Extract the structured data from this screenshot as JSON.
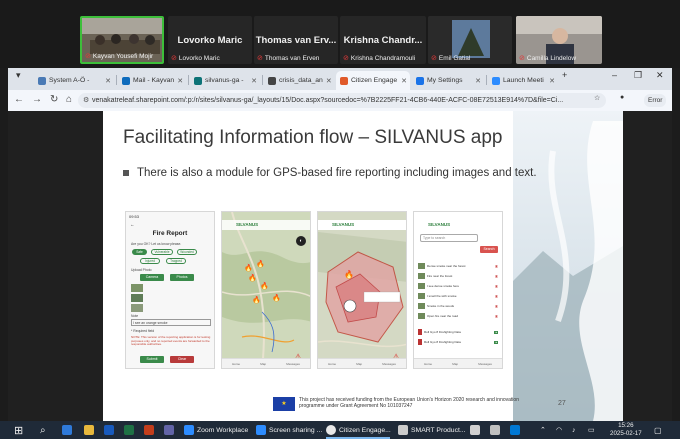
{
  "zoom": {
    "participants": [
      {
        "name": "Kayvan Yousefi Mojir",
        "has_video": true,
        "active": true
      },
      {
        "name": "Lovorko Maric",
        "sub": "Lovorko Maric",
        "has_video": false
      },
      {
        "name": "Thomas van Erv...",
        "sub": "Thomas van Erven",
        "has_video": false
      },
      {
        "name": "Krishna Chandr...",
        "sub": "Krishna Chandramouli",
        "has_video": false
      },
      {
        "name": "Emil Gatial",
        "has_video": true
      },
      {
        "name": "Camilla Lindelow",
        "has_video": true
      }
    ]
  },
  "browser": {
    "tabs": [
      {
        "label": "System A-Ö -",
        "color": "#4a7ab5"
      },
      {
        "label": "Mail - Kayvan",
        "color": "#0f6cbd"
      },
      {
        "label": "silvanus-ga -",
        "color": "#0d7377"
      },
      {
        "label": "crisis_data_an",
        "color": "#444444"
      },
      {
        "label": "Citizen Engage",
        "color": "#e05a2b",
        "active": true
      },
      {
        "label": "My Settings",
        "color": "#1a73e8"
      },
      {
        "label": "Launch Meeti",
        "color": "#2d8cff"
      }
    ],
    "new_tab": "+",
    "url": "venakatreleaf.sharepoint.com/:p:/r/sites/silvanus-ga/_layouts/15/Doc.aspx?sourcedoc=%7B2225FF21-4CB6-440E-ACFC-08E72513E914%7D&file=Ci...",
    "error_label": "Error"
  },
  "slide": {
    "title": "Facilitating Information flow – SILVANUS app",
    "bullet": "There is also a module for GPS-based fire reporting including images and text.",
    "page_number": "27",
    "eu_text": "This project has received funding from the European Union's Horizon 2020 research and innovation programme under Grant Agreement No 101037247",
    "screens": {
      "report": {
        "title": "Fire Report",
        "question": "Are you OK? Let us know please.",
        "chips": [
          "Safe",
          "Vulnerable",
          "Wounded",
          "Injured",
          "Trapped"
        ],
        "upload_label": "Upload Photo",
        "camera_button": "Camera",
        "photos_button": "Photos",
        "note_label": "Note",
        "note_value": "I see an orange smoke",
        "required": "* Required field",
        "warning": "NOTE: This version of the reporting application is for testing purposes only, and no reported events are forwarded to the responsible authorities.",
        "submit": "Submit",
        "clear": "Clear"
      },
      "map_app_name": "SILVANUS",
      "list": {
        "search_placeholder": "Type to search",
        "search_button": "Search",
        "items": [
          "Dense smoke near the forest",
          "Fire near the forest",
          "I see dense smoke here",
          "I smell fire with smoke",
          "Smoke in the woods",
          "Open fire near the road",
          "Roll Gyo 8 Firefighting Data",
          "Roll Gyo 8 Firefighting Data"
        ]
      },
      "nav": [
        "Home",
        "Map",
        "Messages"
      ]
    }
  },
  "taskbar": {
    "items": [
      {
        "label": "Zoom Workplace",
        "color": "#2d8cff"
      },
      {
        "label": "Screen sharing ...",
        "color": "#2d8cff"
      },
      {
        "label": "Citizen Engage...",
        "color": "#e8e8e8"
      },
      {
        "label": "SMART Product...",
        "color": "#cccccc"
      }
    ],
    "time": "15:26",
    "date": "2025-02-17"
  }
}
